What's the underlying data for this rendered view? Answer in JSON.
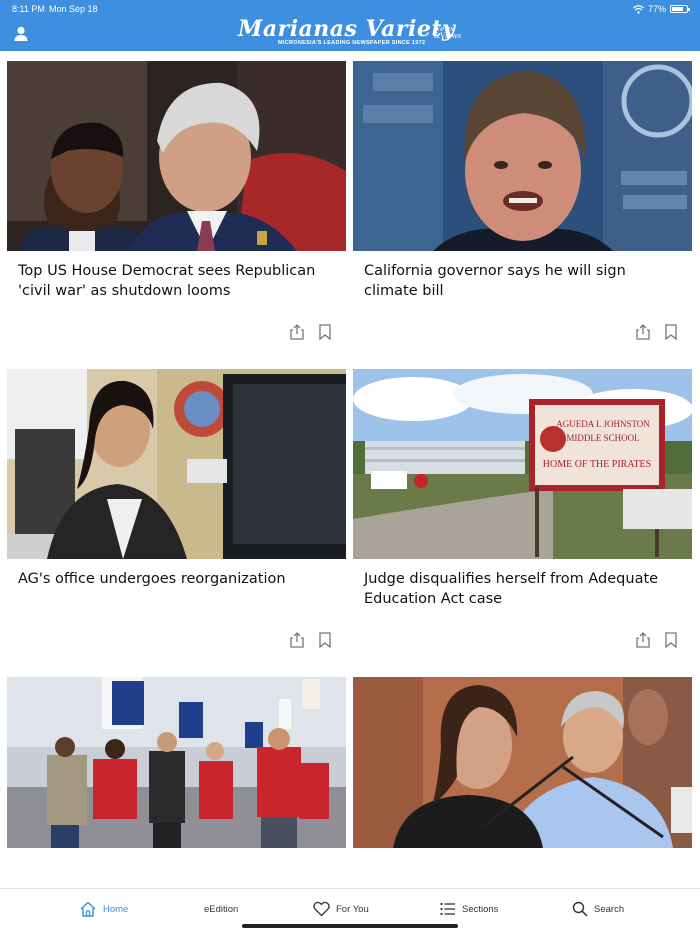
{
  "status_bar": {
    "time": "8:11 PM",
    "date": "Mon Sep 18",
    "battery": "77%",
    "battery_level": 0.77
  },
  "header": {
    "logo_title": "Marianas Variety",
    "logo_tagline": "MICRONESIA'S LEADING NEWSPAPER SINCE 1972",
    "logo_badge_top": "News",
    "logo_badge_bottom": "&Views",
    "accent_color": "#3f8fe0"
  },
  "articles": [
    {
      "headline": "Top US House Democrat sees Republican 'civil war' as shutdown looms"
    },
    {
      "headline": "California governor says he will sign climate bill"
    },
    {
      "headline": "AG's office undergoes reorganization"
    },
    {
      "headline": "Judge disqualifies herself from Adequate Education Act case"
    },
    {
      "headline": ""
    },
    {
      "headline": ""
    }
  ],
  "tabbar": {
    "items": [
      {
        "label": "Home",
        "icon": "home-icon",
        "active": true
      },
      {
        "label": "eEdition",
        "icon": "",
        "active": false
      },
      {
        "label": "For You",
        "icon": "heart-icon",
        "active": false
      },
      {
        "label": "Sections",
        "icon": "list-icon",
        "active": false
      },
      {
        "label": "Search",
        "icon": "search-icon",
        "active": false
      }
    ]
  }
}
